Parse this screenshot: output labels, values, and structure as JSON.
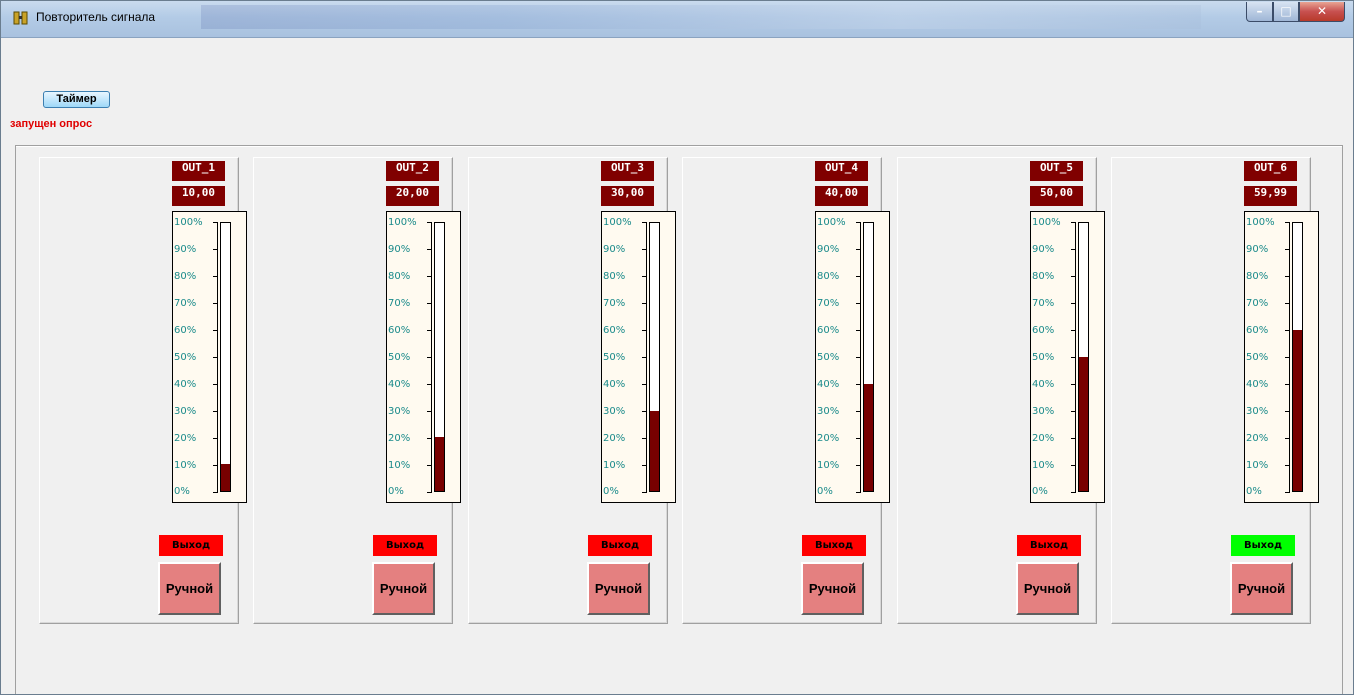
{
  "window": {
    "title": "Повторитель сигнала",
    "controls": {
      "minimize": "–",
      "maximize": "□",
      "close": "✕"
    }
  },
  "toolbar": {
    "timer_button": "Таймер",
    "status": "запущен опрос"
  },
  "gauge_scale": [
    "100%",
    "90%",
    "80%",
    "70%",
    "60%",
    "50%",
    "40%",
    "30%",
    "20%",
    "10%",
    "0%"
  ],
  "channels": [
    {
      "name": "OUT_1",
      "value": "10,00",
      "level": 0.1,
      "output_label": "Выход",
      "output_color": "#ff0000",
      "manual_label": "Ручной"
    },
    {
      "name": "OUT_2",
      "value": "20,00",
      "level": 0.2,
      "output_label": "Выход",
      "output_color": "#ff0000",
      "manual_label": "Ручной"
    },
    {
      "name": "OUT_3",
      "value": "30,00",
      "level": 0.3,
      "output_label": "Выход",
      "output_color": "#ff0000",
      "manual_label": "Ручной"
    },
    {
      "name": "OUT_4",
      "value": "40,00",
      "level": 0.4,
      "output_label": "Выход",
      "output_color": "#ff0000",
      "manual_label": "Ручной"
    },
    {
      "name": "OUT_5",
      "value": "50,00",
      "level": 0.5,
      "output_label": "Выход",
      "output_color": "#ff0000",
      "manual_label": "Ручной"
    },
    {
      "name": "OUT_6",
      "value": "59,99",
      "level": 0.5999,
      "output_label": "Выход",
      "output_color": "#00ff00",
      "manual_label": "Ручной"
    }
  ]
}
